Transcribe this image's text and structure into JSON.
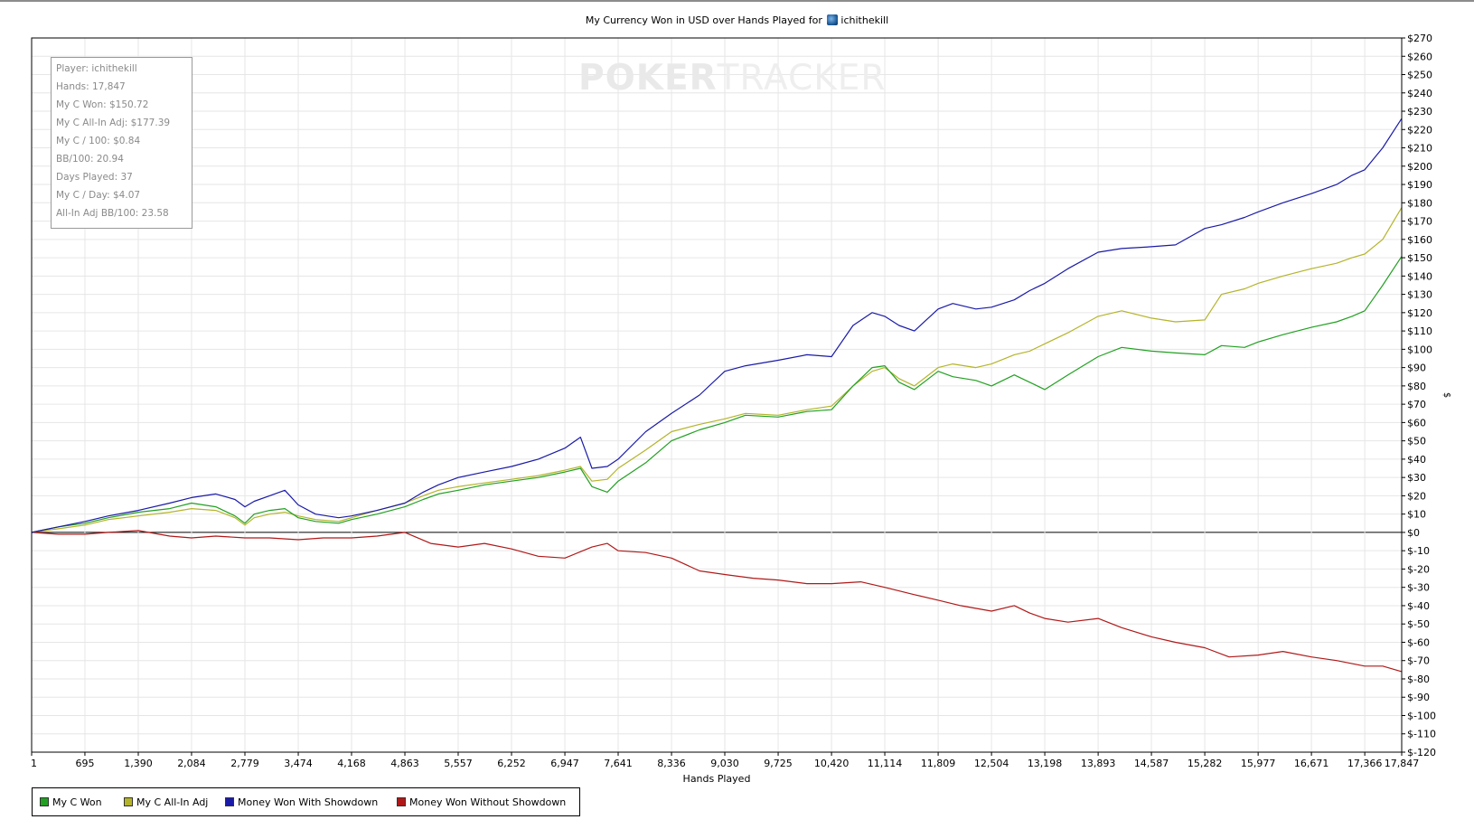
{
  "header": {
    "title_text": "My Currency Won in USD over Hands Played for",
    "player_name": "ichithekill"
  },
  "watermark": {
    "part1": "POKER",
    "part2": "TRACKER"
  },
  "stats_box": {
    "rows": [
      "Player: ichithekill",
      "Hands: 17,847",
      "My C Won: $150.72",
      "My C All-In Adj: $177.39",
      "My C / 100: $0.84",
      "BB/100: 20.94",
      "Days Played: 37",
      "My C / Day: $4.07",
      "All-In Adj BB/100: 23.58"
    ]
  },
  "colors": {
    "my_c_won": "#22a022",
    "my_c_all_in_adj": "#b4b42a",
    "with_showdown": "#1a1aa8",
    "without_showdown": "#b01818",
    "grid": "#e6e6e6",
    "zero_line": "#000000"
  },
  "chart_data": {
    "type": "line",
    "title": "My Currency Won in USD over Hands Played for ichithekill",
    "xlabel": "Hands Played",
    "ylabel": "$",
    "xlim": [
      1,
      17847
    ],
    "ylim": [
      -120,
      270
    ],
    "grid": true,
    "legend_position": "bottom-left",
    "x_ticks": [
      1,
      695,
      1390,
      2084,
      2779,
      3474,
      4168,
      4863,
      5557,
      6252,
      6947,
      7641,
      8336,
      9030,
      9725,
      10420,
      11114,
      11809,
      12504,
      13198,
      13893,
      14587,
      15282,
      15977,
      16671,
      17366,
      17847
    ],
    "x_tick_labels": [
      "1",
      "695",
      "1,390",
      "2,084",
      "2,779",
      "3,474",
      "4,168",
      "4,863",
      "5,557",
      "6,252",
      "6,947",
      "7,641",
      "8,336",
      "9,030",
      "9,725",
      "10,420",
      "11,114",
      "11,809",
      "12,504",
      "13,198",
      "13,893",
      "14,587",
      "15,282",
      "15,977",
      "16,671",
      "17,366",
      "17,847"
    ],
    "y_ticks": [
      270,
      260,
      250,
      240,
      230,
      220,
      210,
      200,
      190,
      180,
      170,
      160,
      150,
      140,
      130,
      120,
      110,
      100,
      90,
      80,
      70,
      60,
      50,
      40,
      30,
      20,
      10,
      0,
      -10,
      -20,
      -30,
      -40,
      -50,
      -60,
      -70,
      -80,
      -90,
      -100,
      -110,
      -120
    ],
    "y_tick_labels": [
      "$270",
      "$260",
      "$250",
      "$240",
      "$230",
      "$220",
      "$210",
      "$200",
      "$190",
      "$180",
      "$170",
      "$160",
      "$150",
      "$140",
      "$130",
      "$120",
      "$110",
      "$100",
      "$90",
      "$80",
      "$70",
      "$60",
      "$50",
      "$40",
      "$30",
      "$20",
      "$10",
      "$0",
      "$-10",
      "$-20",
      "$-30",
      "$-40",
      "$-50",
      "$-60",
      "$-70",
      "$-80",
      "$-90",
      "$-100",
      "$-110",
      "$-120"
    ],
    "series": [
      {
        "name": "My C Won",
        "x": [
          1,
          350,
          695,
          1000,
          1390,
          1800,
          2084,
          2400,
          2650,
          2779,
          2900,
          3100,
          3300,
          3474,
          3700,
          4000,
          4168,
          4500,
          4863,
          5100,
          5300,
          5557,
          5900,
          6252,
          6600,
          6947,
          7150,
          7300,
          7500,
          7641,
          8000,
          8336,
          8700,
          9030,
          9300,
          9725,
          10100,
          10420,
          10700,
          10950,
          11114,
          11300,
          11500,
          11809,
          12000,
          12300,
          12504,
          12800,
          13000,
          13198,
          13500,
          13893,
          14200,
          14587,
          14900,
          15282,
          15500,
          15800,
          15977,
          16300,
          16671,
          17000,
          17200,
          17366,
          17600,
          17847
        ],
        "y": [
          0,
          3,
          5,
          8,
          11,
          13,
          16,
          14,
          9,
          5,
          10,
          12,
          13,
          8,
          6,
          5,
          7,
          10,
          14,
          18,
          21,
          23,
          26,
          28,
          30,
          33,
          35,
          25,
          22,
          28,
          38,
          50,
          56,
          60,
          64,
          63,
          66,
          67,
          80,
          90,
          91,
          82,
          78,
          88,
          85,
          83,
          80,
          86,
          82,
          78,
          86,
          96,
          101,
          99,
          98,
          97,
          102,
          101,
          104,
          108,
          112,
          115,
          118,
          121,
          135,
          150.72
        ]
      },
      {
        "name": "My C All-In Adj",
        "x": [
          1,
          350,
          695,
          1000,
          1390,
          1800,
          2084,
          2400,
          2650,
          2779,
          2900,
          3100,
          3300,
          3474,
          3700,
          4000,
          4168,
          4500,
          4863,
          5100,
          5300,
          5557,
          5900,
          6252,
          6600,
          6947,
          7150,
          7300,
          7500,
          7641,
          8000,
          8336,
          8700,
          9030,
          9300,
          9725,
          10100,
          10420,
          10700,
          10950,
          11114,
          11300,
          11500,
          11809,
          12000,
          12300,
          12504,
          12800,
          13000,
          13198,
          13500,
          13893,
          14200,
          14587,
          14900,
          15282,
          15500,
          15800,
          15977,
          16300,
          16671,
          17000,
          17200,
          17366,
          17600,
          17847
        ],
        "y": [
          0,
          2,
          4,
          7,
          9,
          11,
          13,
          12,
          8,
          4,
          8,
          10,
          11,
          9,
          7,
          6,
          8,
          12,
          16,
          20,
          23,
          25,
          27,
          29,
          31,
          34,
          36,
          28,
          29,
          35,
          45,
          55,
          59,
          62,
          65,
          64,
          67,
          69,
          80,
          88,
          90,
          84,
          80,
          90,
          92,
          90,
          92,
          97,
          99,
          103,
          109,
          118,
          121,
          117,
          115,
          116,
          130,
          133,
          136,
          140,
          144,
          147,
          150,
          152,
          160,
          177.39
        ]
      },
      {
        "name": "Money Won With Showdown",
        "x": [
          1,
          350,
          695,
          1000,
          1390,
          1800,
          2084,
          2400,
          2650,
          2779,
          2900,
          3100,
          3300,
          3474,
          3700,
          4000,
          4168,
          4500,
          4863,
          5100,
          5300,
          5557,
          5900,
          6252,
          6600,
          6947,
          7150,
          7300,
          7500,
          7641,
          8000,
          8336,
          8700,
          9030,
          9300,
          9725,
          10100,
          10420,
          10700,
          10950,
          11114,
          11300,
          11500,
          11809,
          12000,
          12300,
          12504,
          12800,
          13000,
          13198,
          13500,
          13893,
          14200,
          14587,
          14900,
          15282,
          15500,
          15800,
          15977,
          16300,
          16671,
          17000,
          17200,
          17366,
          17600,
          17847
        ],
        "y": [
          0,
          3,
          6,
          9,
          12,
          16,
          19,
          21,
          18,
          14,
          17,
          20,
          23,
          15,
          10,
          8,
          9,
          12,
          16,
          22,
          26,
          30,
          33,
          36,
          40,
          46,
          52,
          35,
          36,
          40,
          55,
          65,
          75,
          88,
          91,
          94,
          97,
          96,
          113,
          120,
          118,
          113,
          110,
          122,
          125,
          122,
          123,
          127,
          132,
          136,
          144,
          153,
          155,
          156,
          157,
          166,
          168,
          172,
          175,
          180,
          185,
          190,
          195,
          198,
          210,
          226
        ]
      },
      {
        "name": "Money Won Without Showdown",
        "x": [
          1,
          350,
          695,
          1000,
          1390,
          1800,
          2084,
          2400,
          2779,
          3100,
          3474,
          3800,
          4168,
          4500,
          4863,
          5200,
          5557,
          5900,
          6252,
          6600,
          6947,
          7300,
          7500,
          7641,
          8000,
          8336,
          8700,
          9030,
          9400,
          9725,
          10100,
          10420,
          10800,
          11114,
          11500,
          11809,
          12100,
          12504,
          12800,
          13000,
          13198,
          13500,
          13893,
          14200,
          14587,
          14900,
          15282,
          15600,
          15977,
          16300,
          16671,
          17000,
          17366,
          17600,
          17847
        ],
        "y": [
          0,
          -1,
          -1,
          0,
          1,
          -2,
          -3,
          -2,
          -3,
          -3,
          -4,
          -3,
          -3,
          -2,
          0,
          -6,
          -8,
          -6,
          -9,
          -13,
          -14,
          -8,
          -6,
          -10,
          -11,
          -14,
          -21,
          -23,
          -25,
          -26,
          -28,
          -28,
          -27,
          -30,
          -34,
          -37,
          -40,
          -43,
          -40,
          -44,
          -47,
          -49,
          -47,
          -52,
          -57,
          -60,
          -63,
          -68,
          -67,
          -65,
          -68,
          -70,
          -73,
          -73,
          -76
        ]
      }
    ]
  }
}
